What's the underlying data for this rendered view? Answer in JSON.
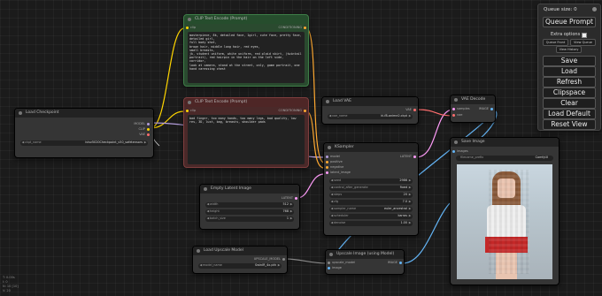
{
  "menu": {
    "queue_size": "Queue size: 0",
    "queue_prompt": "Queue Prompt",
    "extra_options": "Extra options",
    "queue_front": "Queue Front",
    "view_queue": "View Queue",
    "view_history": "View History",
    "save": "Save",
    "load": "Load",
    "refresh": "Refresh",
    "clipspace": "Clipspace",
    "clear": "Clear",
    "load_default": "Load Default",
    "reset_view": "Reset View"
  },
  "nodes": {
    "load_checkpoint": {
      "title": "Load Checkpoint",
      "outputs": [
        "MODEL",
        "CLIP",
        "VAE"
      ],
      "ckpt_label": "ckpt_name",
      "ckpt_value": "ivisv5020Checkpoint_v50_safetensors"
    },
    "clip_positive": {
      "title": "CLIP Text Encode (Prompt)",
      "input": "clip",
      "output": "CONDITIONING",
      "text": "masterpiece, 8k, detailed face, 1girl, cute face, pretty face, detailed girl,\nfull body shot,\nbrown hair, middle long hair, red eyes,\nsmall breasts,\njk, student uniform, white uniform, red plaid skirt, (twintail portrait), red hairpin in the hair on the left side,\ncorridor,\nlook at camera, stand at the street, only, game portrait, one hand caressing chest"
    },
    "clip_negative": {
      "title": "CLIP Text Encode (Prompt)",
      "input": "clip",
      "output": "CONDITIONING",
      "text": "bad finger, too many hands, too many legs, bad quality, low res, 3D, lust, bag, breasts, shoulder pads"
    },
    "load_vae": {
      "title": "Load VAE",
      "output": "VAE",
      "vae_label": "vae_name",
      "vae_value": "kl-f8-anime2.ckpt"
    },
    "vae_decode": {
      "title": "VAE Decode",
      "inputs": [
        "samples",
        "vae"
      ],
      "output": "IMAGE"
    },
    "ksampler": {
      "title": "KSampler",
      "inputs": [
        "model",
        "positive",
        "negative",
        "latent_image"
      ],
      "output": "LATENT",
      "widgets": [
        {
          "label": "seed",
          "value": "2986"
        },
        {
          "label": "control_after_generate",
          "value": "fixed"
        },
        {
          "label": "steps",
          "value": "20"
        },
        {
          "label": "cfg",
          "value": "7.0"
        },
        {
          "label": "sampler_name",
          "value": "euler_ancestral"
        },
        {
          "label": "scheduler",
          "value": "karras"
        },
        {
          "label": "denoise",
          "value": "1.00"
        }
      ]
    },
    "empty_latent": {
      "title": "Empty Latent Image",
      "output": "LATENT",
      "widgets": [
        {
          "label": "width",
          "value": "512"
        },
        {
          "label": "height",
          "value": "768"
        },
        {
          "label": "batch_size",
          "value": "1"
        }
      ]
    },
    "save_image": {
      "title": "Save Image",
      "input": "images",
      "prefix_label": "filename_prefix",
      "prefix_value": "ComfyUI"
    },
    "load_upscale": {
      "title": "Load Upscale Model",
      "output": "UPSCALE_MODEL",
      "model_label": "model_name",
      "model_value": "SwinIR_4x.pth"
    },
    "upscale_image": {
      "title": "Upscale Image (using Model)",
      "inputs": [
        "upscale_model",
        "image"
      ],
      "output": "IMAGE"
    }
  },
  "status": [
    "T: 0.00s",
    "I: 0",
    "N: 10 [10]",
    "V: 20"
  ],
  "colors": {
    "model_wire": "#b39ddb",
    "clip_wire": "#ffd500",
    "vae_wire": "#ff6e6e",
    "conditioning_wire": "#ffa931",
    "latent_wire": "#ff9cf9",
    "image_wire": "#64b5f6",
    "upscale_wire": "#888888",
    "default_wire": "#dddddd"
  }
}
